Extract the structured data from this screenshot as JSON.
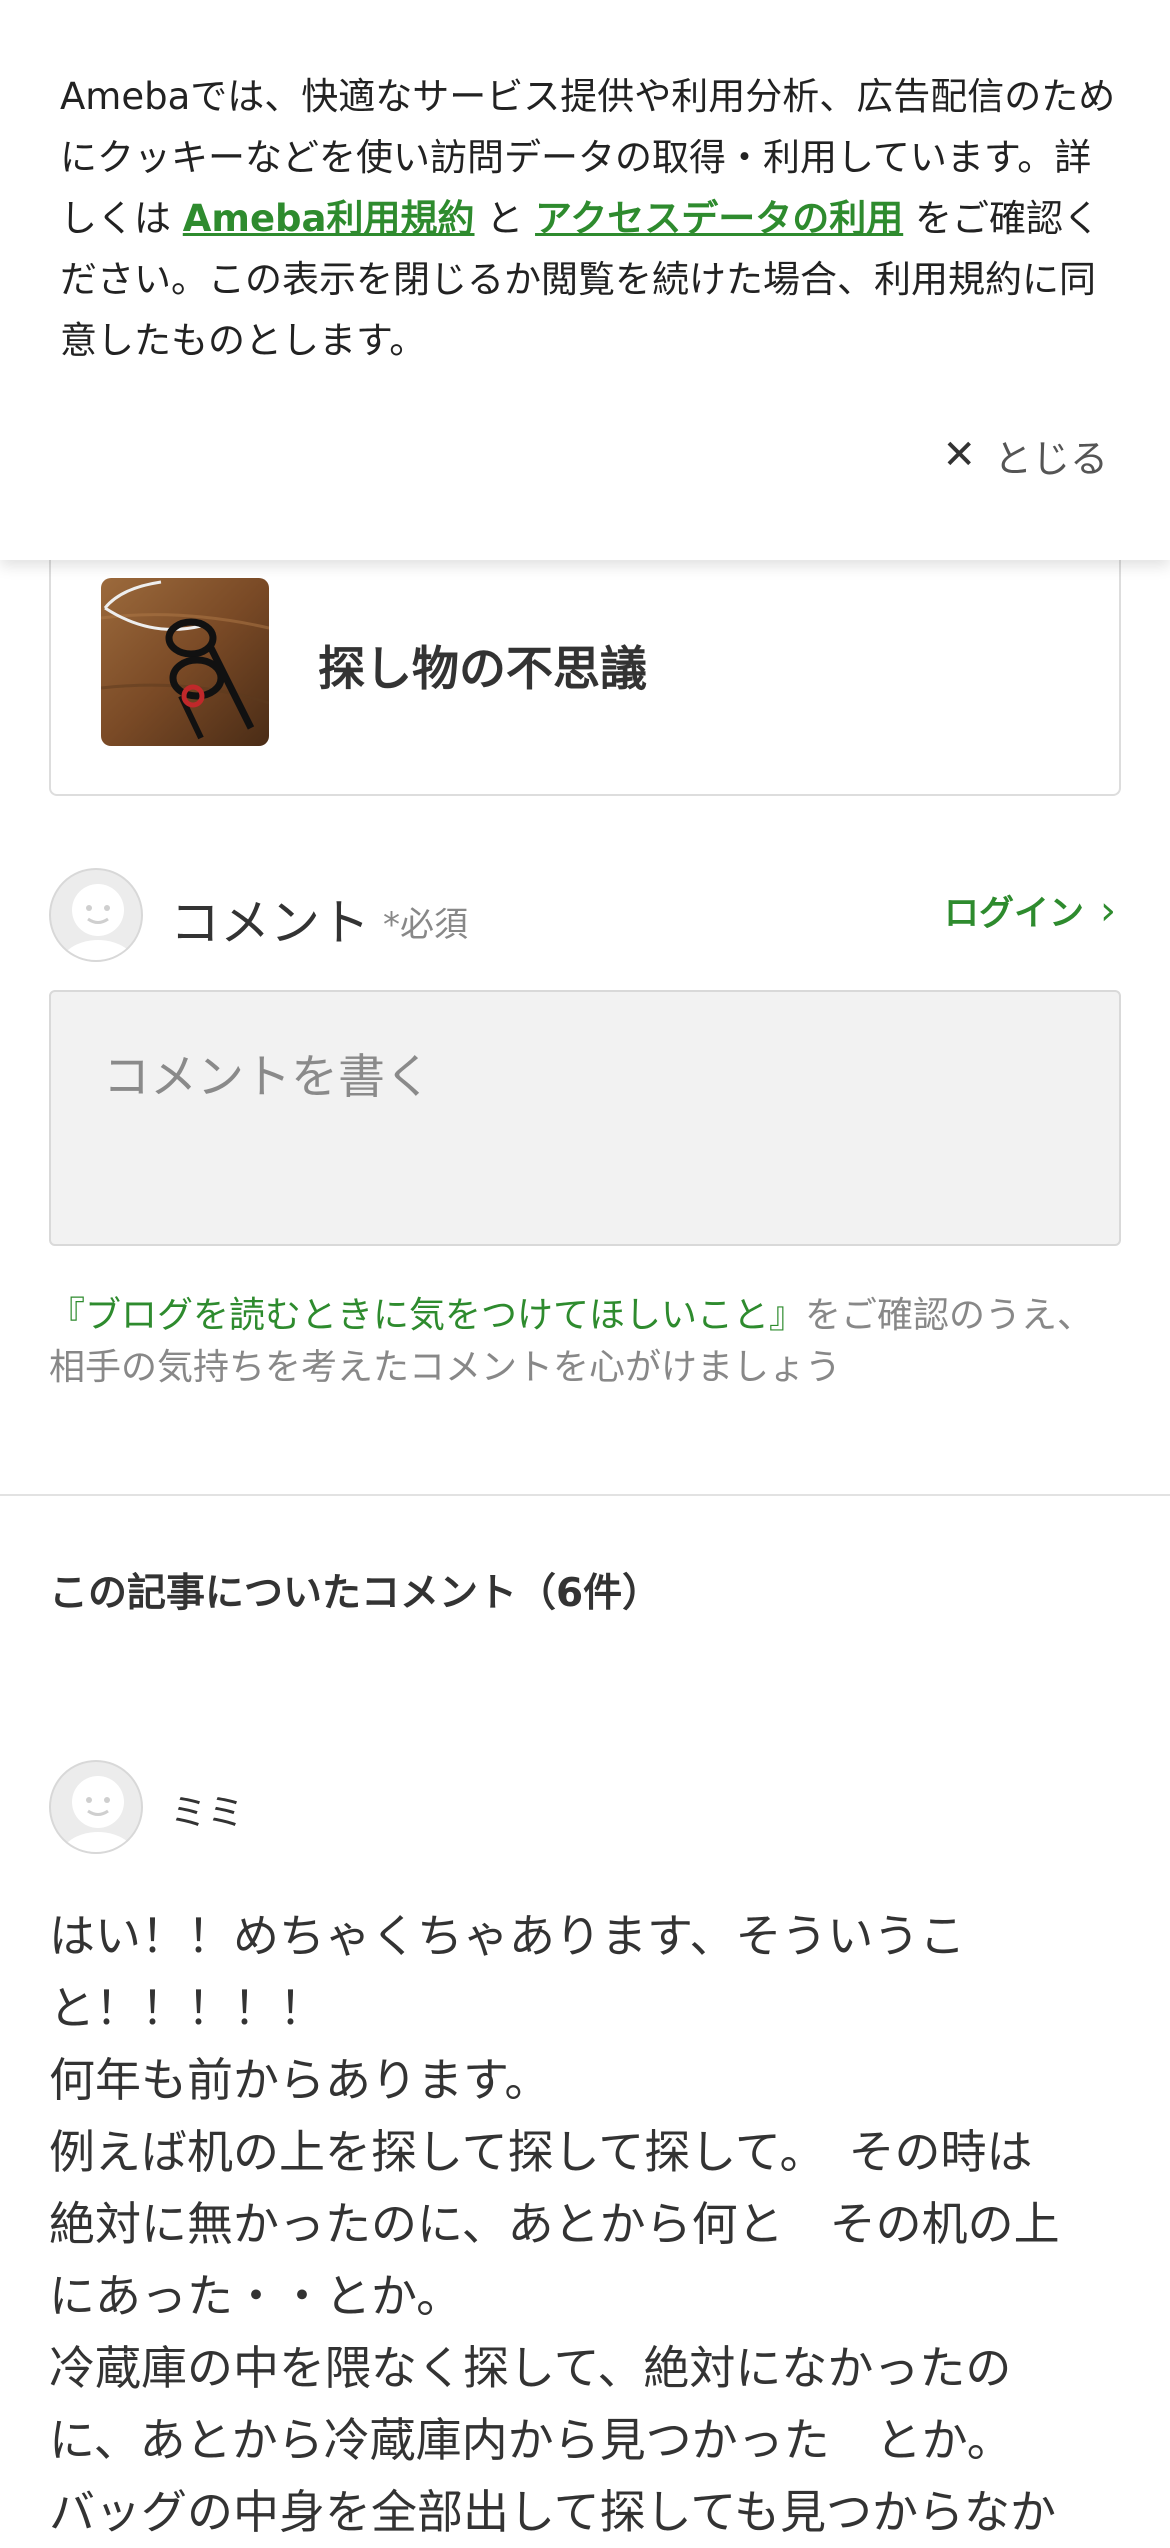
{
  "cookie_banner": {
    "text_part1": "Amebaでは、快適なサービス提供や利用分析、広告配信のためにクッキーなどを使い訪問データの取得・利用しています。詳しくは ",
    "link_terms": "Ameba利用規約",
    "text_and": " と ",
    "link_access": "アクセスデータの利用",
    "text_part2": " をご確認ください。この表示を閉じるか閲覧を続けた場合、利用規約に同意したものとします。",
    "close_label": "とじる",
    "close_icon": "close-icon"
  },
  "article_card": {
    "title": "探し物の不思議",
    "thumbnail_icon": "eyeglasses-photo"
  },
  "comment_form": {
    "label": "コメント",
    "required": "*必須",
    "login": "ログイン",
    "placeholder": "コメントを書く",
    "note_link": "『ブログを読むときに気をつけてほしいこと』",
    "note_rest": "をご確認のうえ、相手の気持ちを考えたコメントを心がけましょう"
  },
  "comments_section": {
    "heading": "この記事についたコメント（6件）",
    "comments": [
      {
        "author": "ミミ",
        "lines": [
          "はい！！めちゃくちゃあります、そういうこ",
          "と！！！！！",
          "何年も前からあります。",
          "例えば机の上を探して探して探して。　その時は",
          "絶対に無かったのに、あとから何と　その机の上",
          "にあった・・とか。",
          "冷蔵庫の中を隈なく探して、絶対になかったの",
          "に、あとから冷蔵庫内から見つかった　とか。",
          "バッグの中身を全部出して探しても見つからなか"
        ]
      }
    ]
  },
  "colors": {
    "accent_green": "#2e8b2e",
    "text": "#333333",
    "muted": "#888888"
  }
}
